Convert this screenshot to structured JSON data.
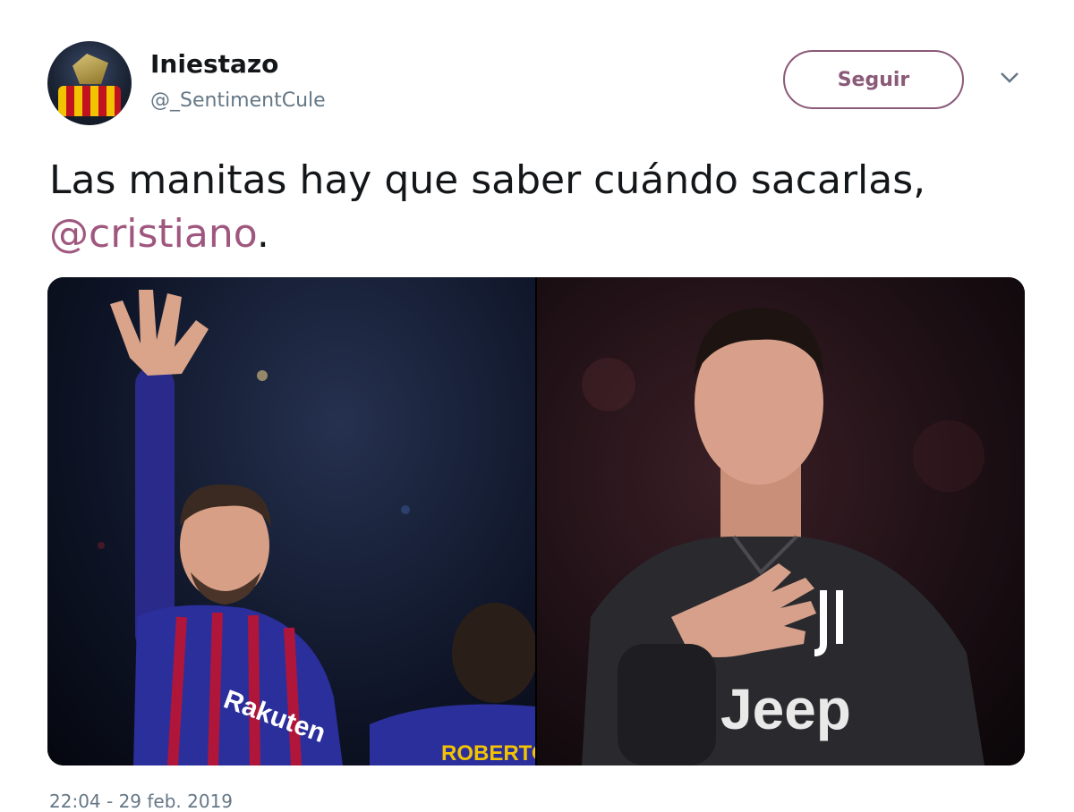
{
  "tweet": {
    "author_name": "Iniestazo",
    "author_handle": "@_SentimentCule",
    "follow_label": "Seguir",
    "text_main": "Las manitas hay que saber cuándo sacarlas,",
    "mention": "@cristiano",
    "text_end": ".",
    "date": "22:04 - 29 feb. 2019"
  },
  "media": {
    "left_photo": {
      "jersey_sponsor": "Rakuten",
      "back_name": "ROBERTO"
    },
    "right_photo": {
      "jersey_sponsor": "Jeep"
    }
  },
  "colors": {
    "accent": "#a0577f",
    "follow_border": "#8a5a78",
    "secondary_text": "#657786"
  },
  "icons": [
    "avatar-image",
    "chevron-down-icon"
  ]
}
